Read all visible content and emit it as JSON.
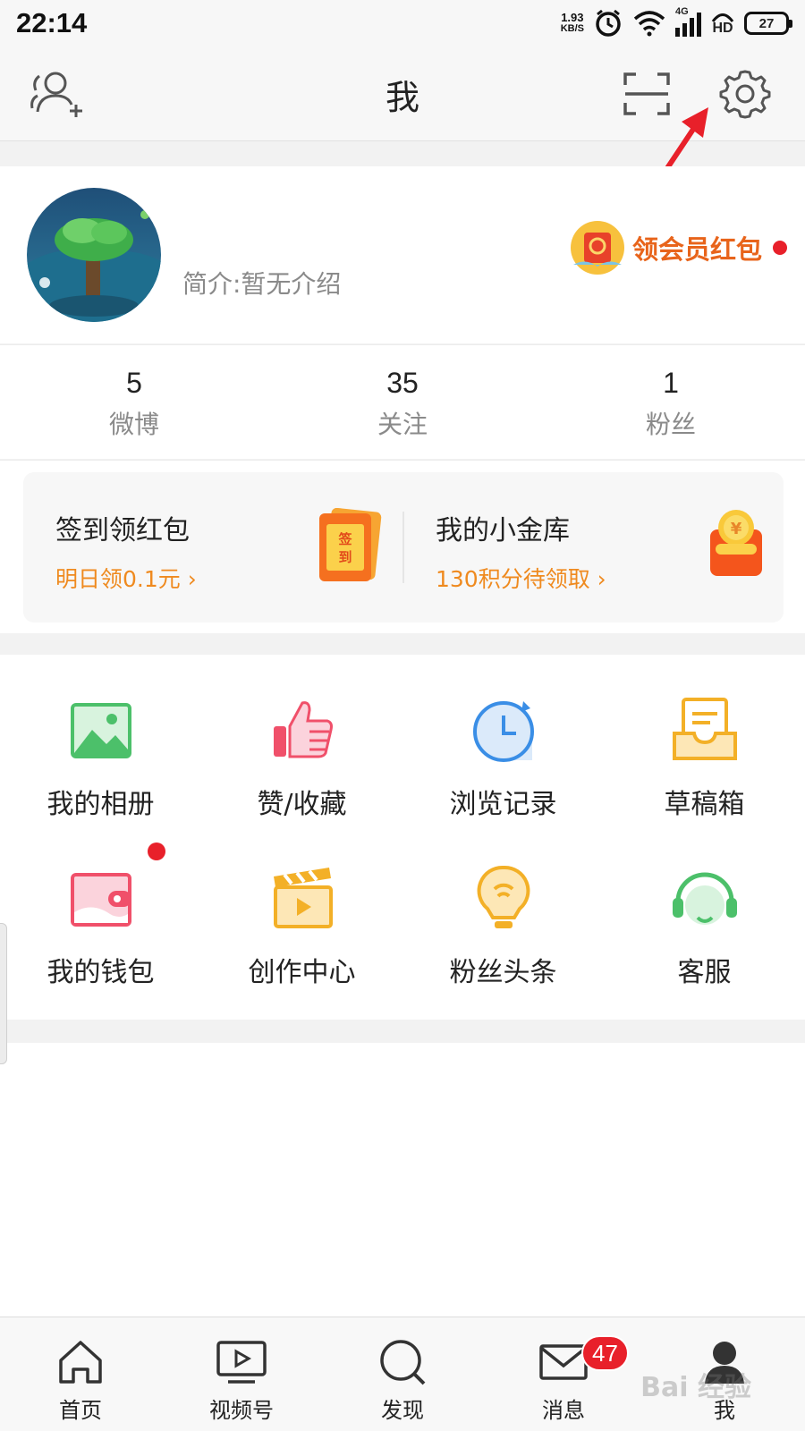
{
  "status_bar": {
    "time": "22:14",
    "net_speed_value": "1.93",
    "net_speed_unit": "KB/S",
    "network": "4G",
    "hd_label": "HD",
    "battery": "27"
  },
  "header": {
    "title": "我"
  },
  "profile": {
    "bio": "简介:暂无介绍",
    "vip_label": "领会员红包"
  },
  "stats": [
    {
      "value": "5",
      "label": "微博"
    },
    {
      "value": "35",
      "label": "关注"
    },
    {
      "value": "1",
      "label": "粉丝"
    }
  ],
  "promo": {
    "checkin": {
      "title": "签到领红包",
      "subtitle": "明日领0.1元 ›",
      "icon_text": "签到"
    },
    "vault": {
      "title": "我的小金库",
      "subtitle": "130积分待领取 ›",
      "icon_text": "¥"
    }
  },
  "grid": [
    {
      "label": "我的相册",
      "icon": "photo-album-icon",
      "color": "#4cc06a"
    },
    {
      "label": "赞/收藏",
      "icon": "thumbs-up-icon",
      "color": "#f0506a"
    },
    {
      "label": "浏览记录",
      "icon": "history-clock-icon",
      "color": "#3a8ee6"
    },
    {
      "label": "草稿箱",
      "icon": "draft-box-icon",
      "color": "#f3b027"
    },
    {
      "label": "我的钱包",
      "icon": "wallet-icon",
      "color": "#f0506a"
    },
    {
      "label": "创作中心",
      "icon": "clapperboard-icon",
      "color": "#f3b027"
    },
    {
      "label": "粉丝头条",
      "icon": "lightbulb-icon",
      "color": "#f3b027"
    },
    {
      "label": "客服",
      "icon": "headset-icon",
      "color": "#4cc06a"
    }
  ],
  "tabbar": [
    {
      "label": "首页",
      "icon": "home-icon"
    },
    {
      "label": "视频号",
      "icon": "video-icon"
    },
    {
      "label": "发现",
      "icon": "search-icon"
    },
    {
      "label": "消息",
      "icon": "mail-icon",
      "badge": "47"
    },
    {
      "label": "我",
      "icon": "profile-icon"
    }
  ],
  "watermark": "Bai 经验",
  "colors": {
    "accent_orange": "#ef8a1f",
    "badge_red": "#e8202a",
    "arrow_red": "#e8202a"
  }
}
